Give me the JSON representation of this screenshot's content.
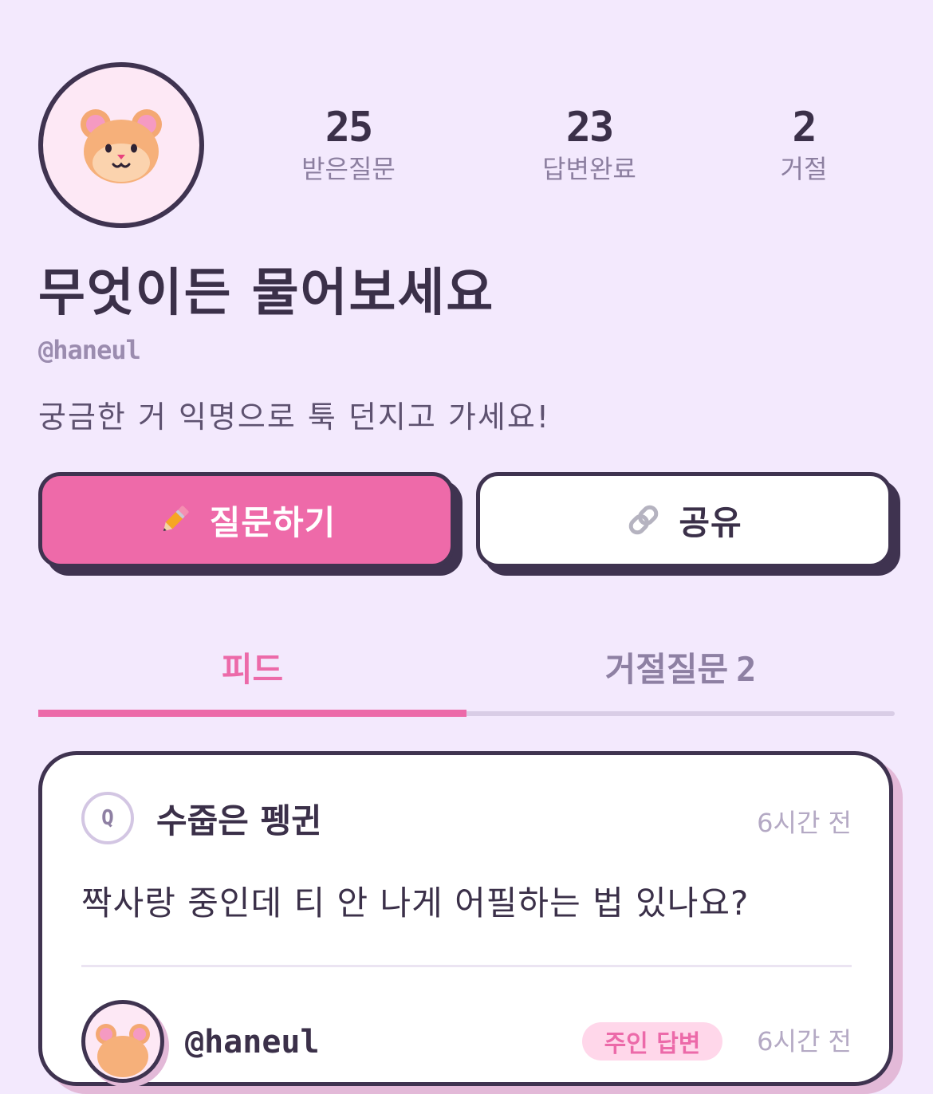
{
  "profile": {
    "avatar_icon": "hamster-icon",
    "title": "무엇이든 물어보세요",
    "handle": "@haneul",
    "bio": "궁금한 거 익명으로 툭 던지고 가세요!"
  },
  "stats": [
    {
      "value": "25",
      "label": "받은질문"
    },
    {
      "value": "23",
      "label": "답변완료"
    },
    {
      "value": "2",
      "label": "거절"
    }
  ],
  "actions": {
    "ask_label": "질문하기",
    "ask_icon": "pencil-icon",
    "share_label": "공유",
    "share_icon": "link-icon"
  },
  "tabs": {
    "feed_label": "피드",
    "rejected_label": "거절질문",
    "rejected_count": "2",
    "active": "feed"
  },
  "card": {
    "badge": "Q",
    "asker": "수줍은 펭귄",
    "time": "6시간 전",
    "question": "짝사랑 중인데 티 안 나게 어필하는 법 있나요?",
    "answerer": "@haneul",
    "answer_badge": "주인 답변",
    "answer_time": "6시간 전"
  },
  "colors": {
    "background": "#f3e9fd",
    "accent_pink": "#ee6aa9",
    "outline": "#3f3350",
    "muted_text": "#8e80a3"
  }
}
